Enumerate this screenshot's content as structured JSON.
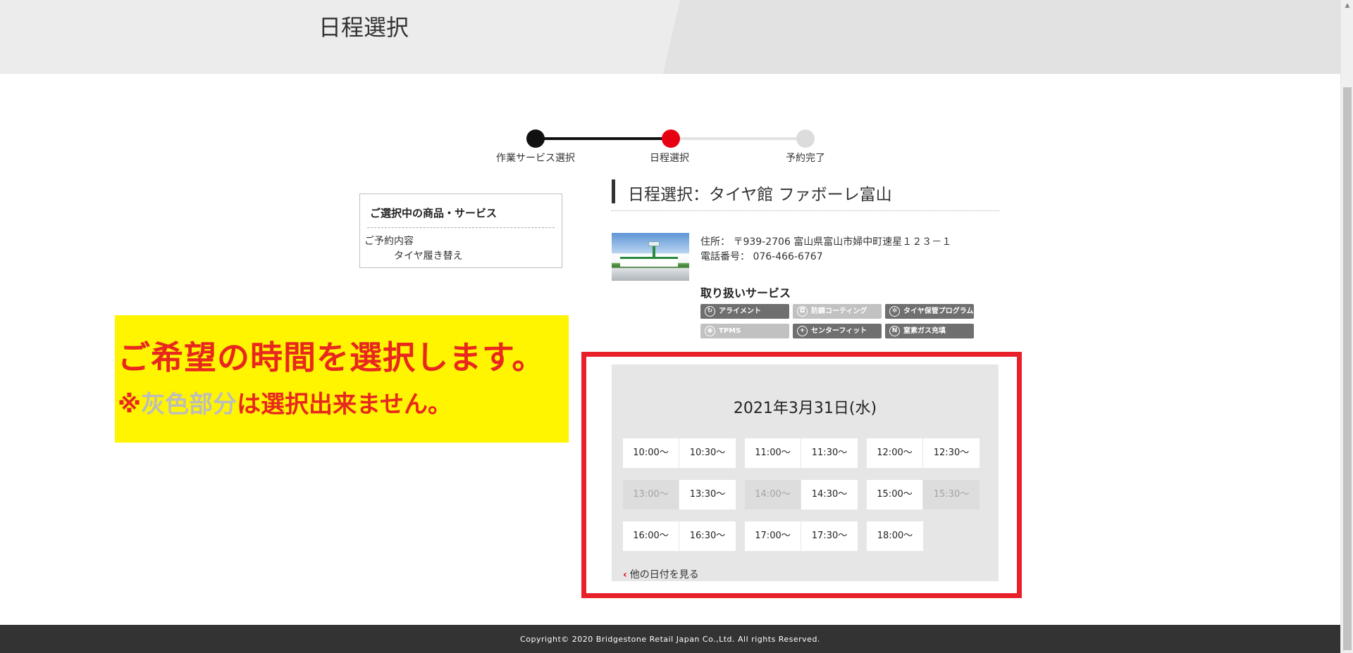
{
  "header": {
    "title": "日程選択"
  },
  "stepper": {
    "steps": [
      {
        "label": "作業サービス選択",
        "state": "done"
      },
      {
        "label": "日程選択",
        "state": "current"
      },
      {
        "label": "予約完了",
        "state": "todo"
      }
    ],
    "colors": {
      "done": "#111111",
      "current": "#e60012",
      "todo": "#dcdcdc"
    }
  },
  "selection": {
    "title": "ご選択中の商品・サービス",
    "label": "ご予約内容",
    "value": "タイヤ履き替え"
  },
  "annotation": {
    "main": "ご希望の時間を選択します。",
    "sub_prefix": "※",
    "sub_gray": "灰色部分",
    "sub_suffix": "は選択出来ません。"
  },
  "store": {
    "heading": "日程選択：タイヤ館 ファボーレ富山",
    "address": "住所： 〒939-2706 富山県富山市婦中町速星１２３－１",
    "phone": "電話番号： 076-466-6767",
    "services_title": "取り扱いサービス",
    "services": [
      {
        "label": "アライメント",
        "available": true,
        "icon": "alignment-icon"
      },
      {
        "label": "防錆コーティング",
        "available": false,
        "icon": "car-coating-icon"
      },
      {
        "label": "タイヤ保管プログラム",
        "available": true,
        "icon": "tire-storage-icon"
      },
      {
        "label": "TPMS",
        "available": false,
        "icon": "tpms-icon"
      },
      {
        "label": "センターフィット",
        "available": true,
        "icon": "center-fit-icon"
      },
      {
        "label": "窒素ガス充填",
        "available": true,
        "icon": "nitrogen-icon"
      }
    ]
  },
  "schedule": {
    "date": "2021年3月31日(水)",
    "slot_groups": [
      [
        {
          "time": "10:00〜",
          "available": true
        },
        {
          "time": "10:30〜",
          "available": true
        }
      ],
      [
        {
          "time": "11:00〜",
          "available": true
        },
        {
          "time": "11:30〜",
          "available": true
        }
      ],
      [
        {
          "time": "12:00〜",
          "available": true
        },
        {
          "time": "12:30〜",
          "available": true
        }
      ],
      [
        {
          "time": "13:00〜",
          "available": false
        },
        {
          "time": "13:30〜",
          "available": true
        }
      ],
      [
        {
          "time": "14:00〜",
          "available": false
        },
        {
          "time": "14:30〜",
          "available": true
        }
      ],
      [
        {
          "time": "15:00〜",
          "available": true
        },
        {
          "time": "15:30〜",
          "available": false
        }
      ],
      [
        {
          "time": "16:00〜",
          "available": true
        },
        {
          "time": "16:30〜",
          "available": true
        }
      ],
      [
        {
          "time": "17:00〜",
          "available": true
        },
        {
          "time": "17:30〜",
          "available": true
        }
      ],
      [
        {
          "time": "18:00〜",
          "available": true
        }
      ]
    ],
    "other_dates": "他の日付を見る"
  },
  "footer": {
    "copyright": "Copyright© 2020 Bridgestone Retail Japan Co.,Ltd. All rights Reserved."
  },
  "colors": {
    "accent": "#e60012",
    "highlight_frame": "#e7202a",
    "annotation_bg": "#fff500",
    "annotation_text": "#e8281e"
  }
}
